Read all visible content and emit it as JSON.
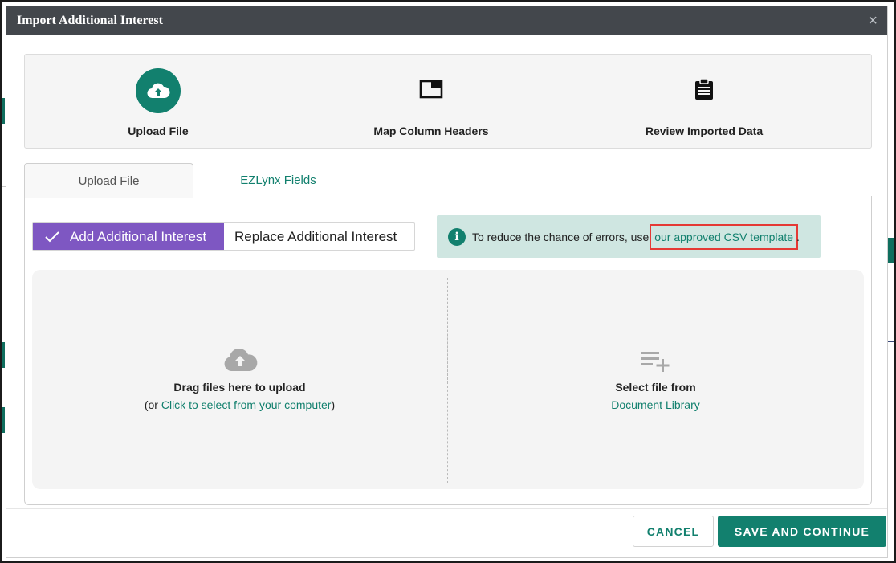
{
  "modal": {
    "title": "Import Additional Interest",
    "close_label": "×"
  },
  "stepper": {
    "steps": [
      {
        "label": "Upload File",
        "icon": "cloud-upload-icon",
        "active": true
      },
      {
        "label": "Map Column Headers",
        "icon": "window-icon",
        "active": false
      },
      {
        "label": "Review Imported Data",
        "icon": "clipboard-icon",
        "active": false
      }
    ]
  },
  "tabs": [
    {
      "label": "Upload File",
      "active": true
    },
    {
      "label": "EZLynx Fields",
      "active": false
    }
  ],
  "mode_toggle": {
    "options": [
      {
        "label": "Add Additional Interest",
        "selected": true
      },
      {
        "label": "Replace Additional Interest",
        "selected": false
      }
    ]
  },
  "info_banner": {
    "text": "To reduce the chance of errors, use",
    "link": "our approved CSV template",
    "trailing": "."
  },
  "dropzone": {
    "upload": {
      "title": "Drag files here to upload",
      "prefix": "(or ",
      "link": "Click to select from your computer",
      "suffix": ")"
    },
    "library": {
      "title": "Select file from",
      "link": "Document Library"
    }
  },
  "footer": {
    "cancel_label": "CANCEL",
    "save_label": "SAVE AND CONTINUE"
  },
  "colors": {
    "accent": "#12806e",
    "toggle_active": "#7e57c2",
    "header_bg": "#43474c",
    "info_bg": "#cfe6e1",
    "highlight": "#e53935"
  }
}
